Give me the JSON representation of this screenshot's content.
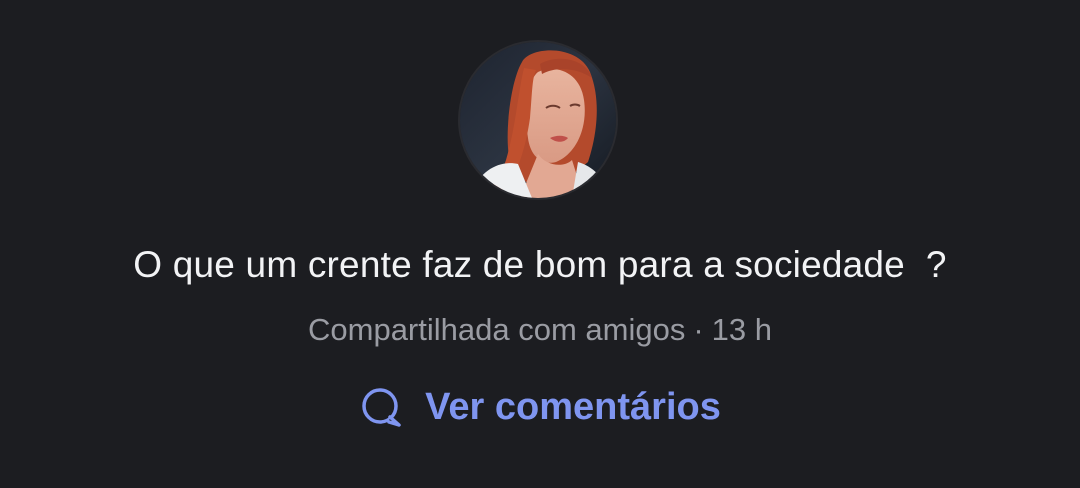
{
  "post": {
    "text": "O que um crente faz de bom para a sociedade  ?",
    "audience": "Compartilhada com amigos",
    "separator": "·",
    "time": "13 h"
  },
  "actions": {
    "view_comments_label": "Ver comentários",
    "view_comments_icon": "comment-icon"
  },
  "colors": {
    "background": "#1c1d21",
    "text": "#f2f3f5",
    "meta": "#9a9ca3",
    "accent": "#7f95f0"
  }
}
